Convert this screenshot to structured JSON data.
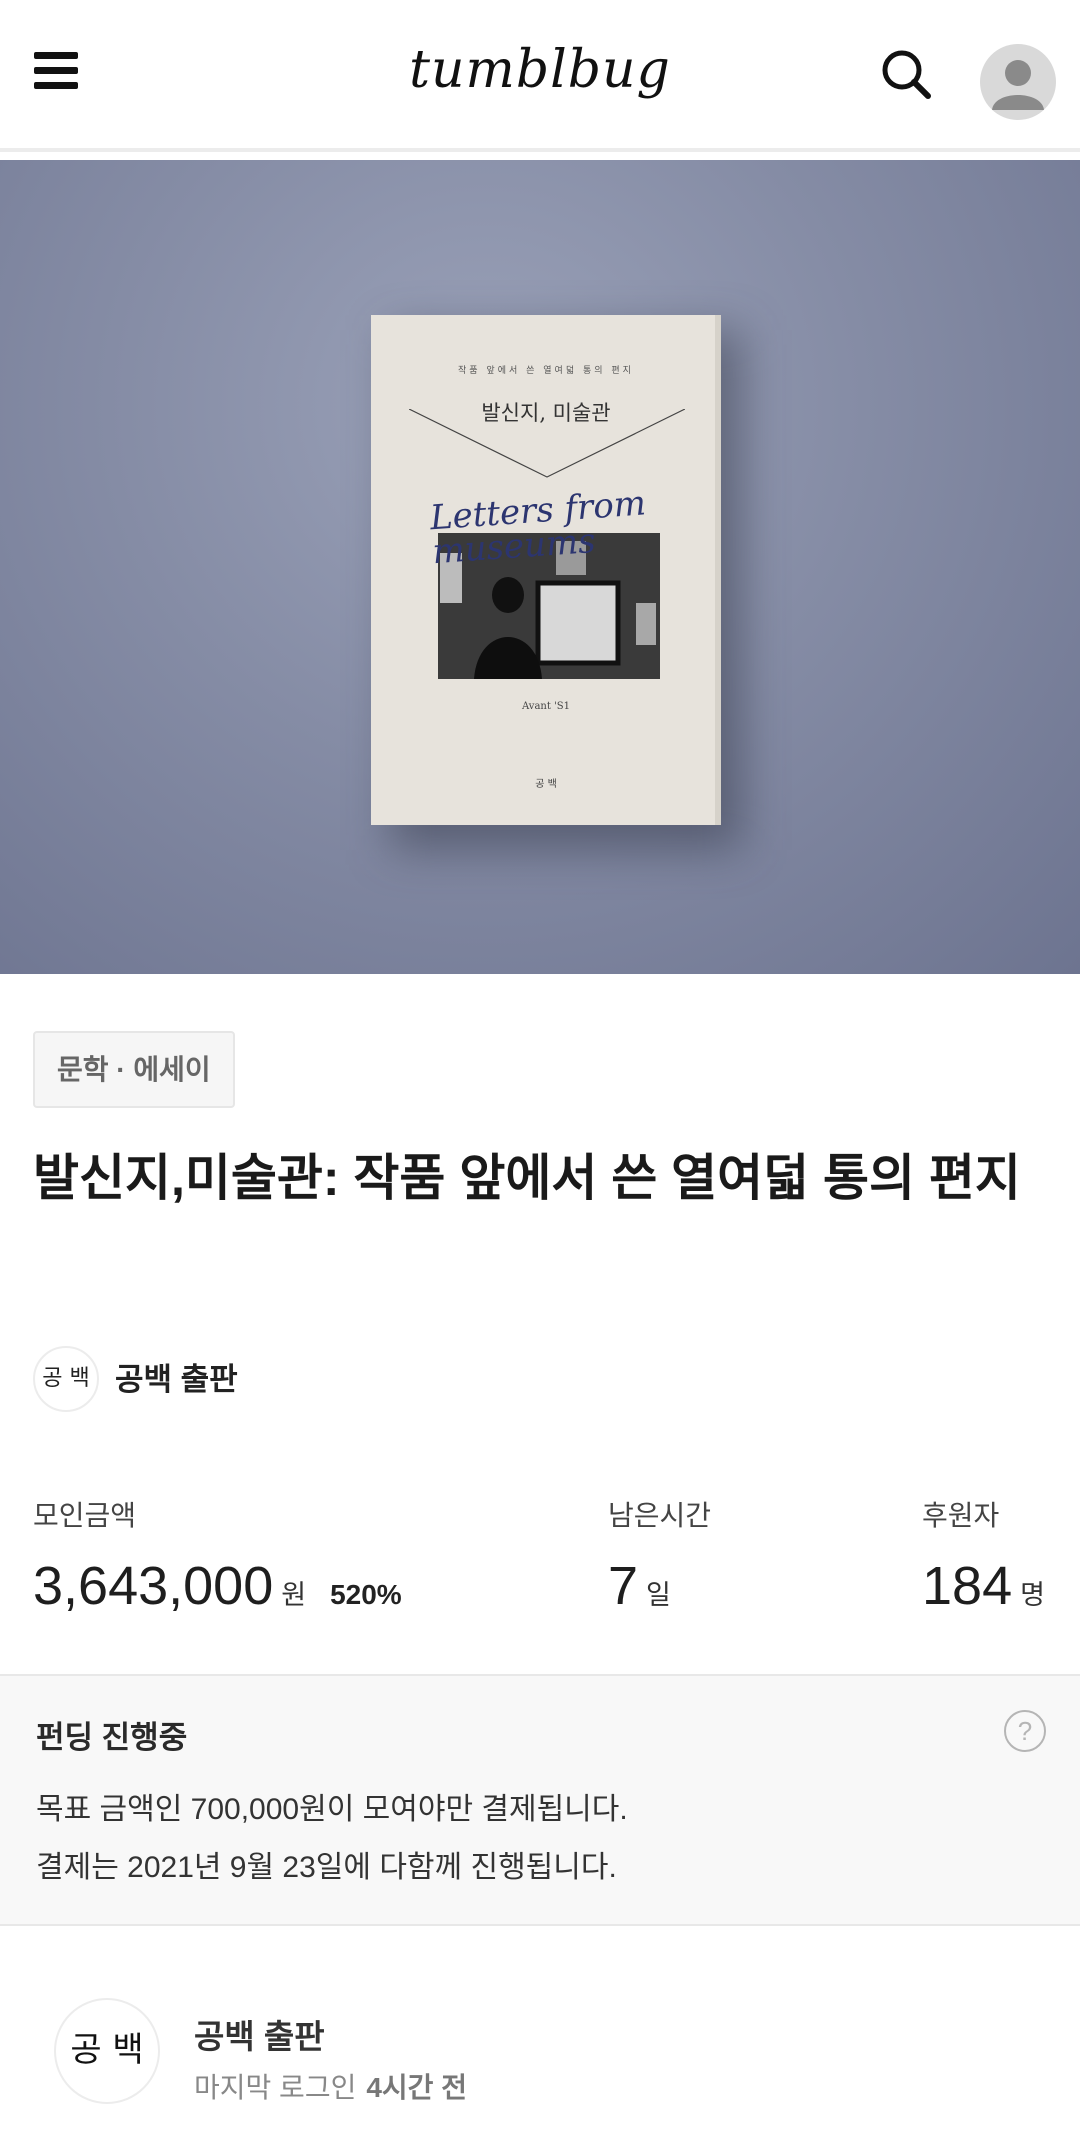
{
  "header": {
    "logo": "tumblbug",
    "menu_icon": "hamburger-menu-icon",
    "search_icon": "search-icon",
    "avatar_icon": "user-avatar-icon"
  },
  "hero": {
    "book_subtitle_small": "작품 앞에서 쓴 열여덟 통의 편지",
    "book_title": "발신지, 미술관",
    "book_script": "Letters from museums",
    "book_author": "Avant 'S1",
    "book_publisher": "공 백",
    "background_color": "#858ca5"
  },
  "project": {
    "category": "문학 · 에세이",
    "title": "발신지,미술관: 작품 앞에서 쓴 열여덟 통의 편지",
    "creator": {
      "logo_text": "공 백",
      "name": "공백 출판"
    }
  },
  "stats": {
    "amount": {
      "label": "모인금액",
      "value": "3,643,000",
      "unit": "원",
      "percent": "520%"
    },
    "time_left": {
      "label": "남은시간",
      "value": "7",
      "unit": "일"
    },
    "backers": {
      "label": "후원자",
      "value": "184",
      "unit": "명"
    }
  },
  "funding_info": {
    "title": "펀딩 진행중",
    "help_icon": "question-circle-icon",
    "line1": "목표 금액인 700,000원이 모여야만 결제됩니다.",
    "line2": "결제는 2021년 9월 23일에 다함께 진행됩니다."
  },
  "creator_card": {
    "logo_text": "공 백",
    "name": "공백 출판",
    "last_login_label": "마지막 로그인",
    "last_login_value": "4시간 전"
  }
}
